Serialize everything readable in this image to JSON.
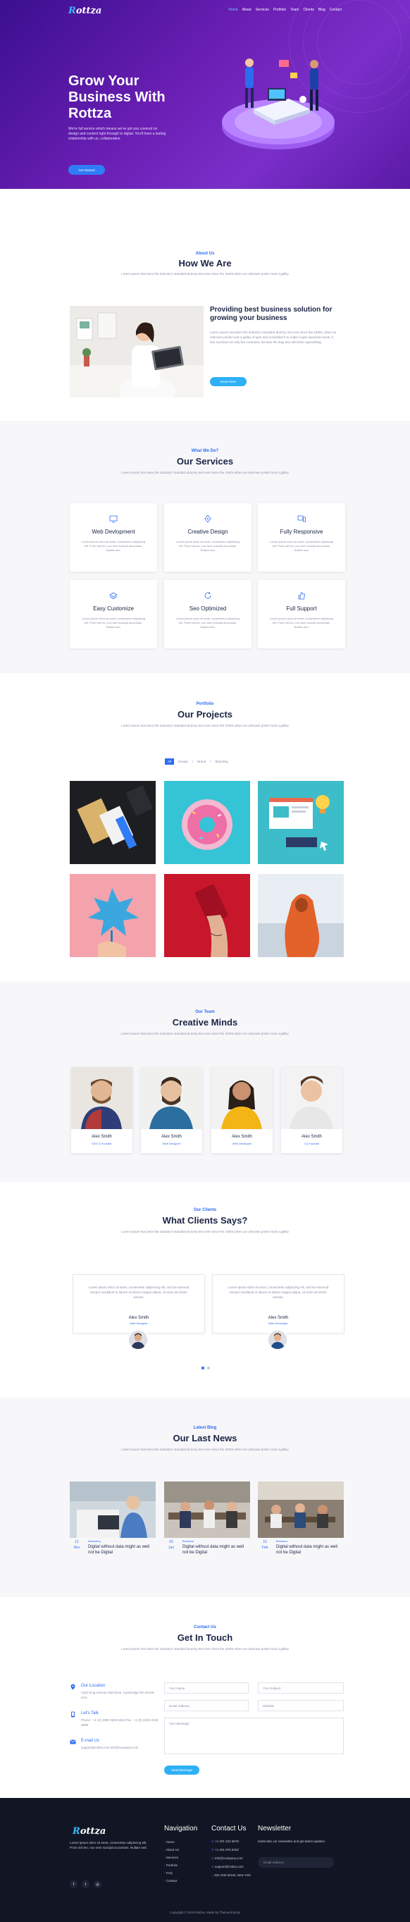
{
  "brand": {
    "logo_r": "R",
    "logo_rest": "ottza"
  },
  "nav": {
    "items": [
      "Home",
      "About",
      "Services",
      "Portfolio",
      "Team",
      "Clients",
      "Blog",
      "Contact"
    ],
    "active": 0
  },
  "hero": {
    "title": "Grow Your Business With Rottza",
    "text": "We're full service which means we've got you covered on design and content right through to digital. You'll have a lasting relationship with us, collaborative.",
    "button": "Get Started"
  },
  "about": {
    "kicker": "About Us",
    "title": "How We Are",
    "subtitle": "Lorem Ipsum has been the industry's standard dummy text ever since the 1500s when an unknown printer took a galley",
    "heading": "Providing best business solution for growing your business",
    "text": "Lorem Ipsum has been the industry's standard dummy text ever since the 1500s, when an unknown printer took a galley of type and scrambled it to make a type specimen book. It has survived not only five centuries, but also the leap into electronic typesetting.",
    "button": "Know More"
  },
  "services": {
    "kicker": "What We Do?",
    "title": "Our Services",
    "subtitle": "Lorem Ipsum has been the industry's standard dummy text ever since the 1500s when an unknown printer took a galley",
    "items": [
      {
        "title": "Web Devlopment",
        "text": "Lorem ipsum dolor sit amet, consectetur adipiscing elit. Proin nisl leo, non sem suscipit accumsan. Nullam sed."
      },
      {
        "title": "Creative Design",
        "text": "Lorem ipsum dolor sit amet, consectetur adipiscing elit. Proin nisl leo, non sem suscipit accumsan. Nullam sed."
      },
      {
        "title": "Fully Responsive",
        "text": "Lorem ipsum dolor sit amet, consectetur adipiscing elit. Proin nisl leo, non sem suscipit accumsan. Nullam sed."
      },
      {
        "title": "Easy Customize",
        "text": "Lorem ipsum dolor sit amet, consectetur adipiscing elit. Proin nisl leo, non sem suscipit accumsan. Nullam sed."
      },
      {
        "title": "Seo Optimized",
        "text": "Lorem ipsum dolor sit amet, consectetur adipiscing elit. Proin nisl leo, non sem suscipit accumsan. Nullam sed."
      },
      {
        "title": "Full Support",
        "text": "Lorem ipsum dolor sit amet, consectetur adipiscing elit. Proin nisl leo, non sem suscipit accumsan. Nullam sed."
      }
    ]
  },
  "projects": {
    "kicker": "Portfolio",
    "title": "Our Projects",
    "subtitle": "Lorem Ipsum has been the industry's standard dummy text ever since the 1500s when an unknown printer took a galley",
    "filters": [
      "All",
      "Design",
      "Brand",
      "Branding"
    ]
  },
  "team": {
    "kicker": "Our Team",
    "title": "Creative Minds",
    "subtitle": "Lorem Ipsum has been the industry's standard dummy text ever since the 1500s when an unknown printer took a galley",
    "members": [
      {
        "name": "Alex Smith",
        "role": "CEO & Founder"
      },
      {
        "name": "Alex Smith",
        "role": "Web Designer"
      },
      {
        "name": "Alex Smith",
        "role": "Web Developer"
      },
      {
        "name": "Alex Smith",
        "role": "Co-Founder"
      }
    ]
  },
  "clients": {
    "kicker": "Our Clients",
    "title": "What Clients Says?",
    "subtitle": "Lorem Ipsum has been the industry's standard dummy text ever since the 1500s when an unknown printer took a galley",
    "items": [
      {
        "text": "Lorem ipsum dolor sit amet, consectetur adipiscing elit, sed do eiusmod tempor incididunt ut labore et dolore magna aliqua. Ut enim ad minim veniam.",
        "name": "Alex Smith",
        "role": "Web Designer"
      },
      {
        "text": "Lorem ipsum dolor sit amet, consectetur adipiscing elit, sed do eiusmod tempor incididunt ut labore et dolore magna aliqua. Ut enim ad minim veniam.",
        "name": "Alex Smith",
        "role": "Web Developer"
      }
    ]
  },
  "blog": {
    "kicker": "Latest Blog",
    "title": "Our Last News",
    "subtitle": "Lorem Ipsum has been the industry's standard dummy text ever since the 1500s when an unknown printer took a galley",
    "items": [
      {
        "day": "12",
        "month": "Nov",
        "category": "Marketing",
        "title": "Digital without data might as well not be Digital"
      },
      {
        "day": "03",
        "month": "Jun",
        "category": "Business",
        "title": "Digital without data might as well not be Digital"
      },
      {
        "day": "15",
        "month": "Feb",
        "category": "Business",
        "title": "Digital without data might as well not be Digital"
      }
    ]
  },
  "contact": {
    "kicker": "Contact Us",
    "title": "Get In Touch",
    "subtitle": "Lorem Ipsum has been the industry's standard dummy text ever since the 1500s when an unknown printer took a galley",
    "info": [
      {
        "title": "Our Location",
        "value": "1422 King Avenue Hall Drive, Cambridge MA 02139 USA"
      },
      {
        "title": "Let's Talk",
        "value": "Phone : +1 (4) 1900 3525 5454 Fax : +1 (0) 3100 2245 3598"
      },
      {
        "title": "E-mail Us",
        "value": "support@rottza.com info@company.com"
      }
    ],
    "fields": {
      "name": "Your Name",
      "subject": "Your Subject",
      "email": "Email Address",
      "website": "Website",
      "message": "Your Message"
    },
    "button": "Send Message"
  },
  "footer": {
    "about": "Lorem ipsum dolor sit amet, consectetur adipiscing elit. Proin nisl leo, non sem suscipit accumsan. Nullam sed.",
    "nav_title": "Navigation",
    "nav_items": [
      "Home",
      "About Us",
      "Services",
      "Portfolio",
      "FAQ",
      "Contact"
    ],
    "contact_title": "Contact Us",
    "contact_items": [
      "+1 201 234 5678",
      "+1 201 876 5432",
      "info@company.com",
      "support@rottza.com",
      "254 Oak Street, New York"
    ],
    "newsletter_title": "Newsletter",
    "newsletter_text": "Subscribe our newsletter and get latest updates",
    "newsletter_placeholder": "Email Address",
    "copyright": "Copyright © 2019 Rottza. Made by ThemesFamily"
  }
}
